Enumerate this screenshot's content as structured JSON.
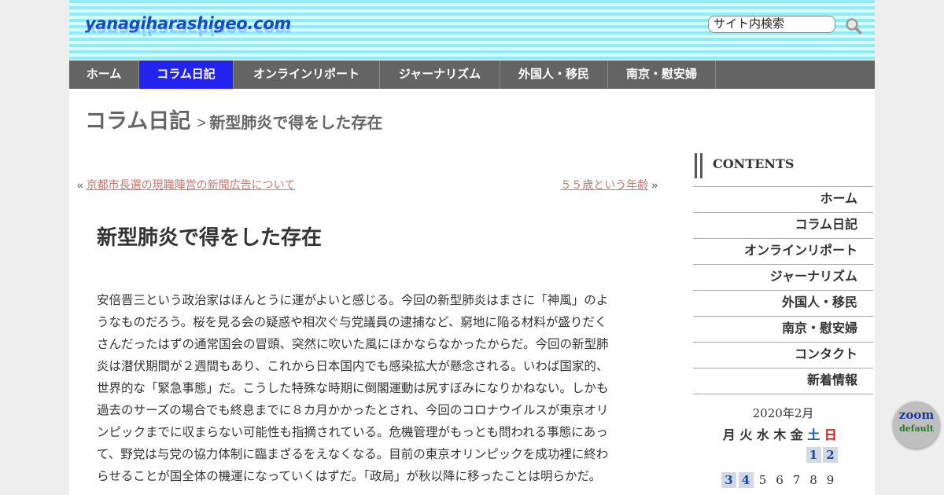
{
  "header": {
    "logo": "yanagiharashigeo.com",
    "search_value": "サイト内検索"
  },
  "nav": {
    "items": [
      {
        "label": "ホーム"
      },
      {
        "label": "コラム日記"
      },
      {
        "label": "オンラインリポート"
      },
      {
        "label": "ジャーナリズム"
      },
      {
        "label": "外国人・移民"
      },
      {
        "label": "南京・慰安婦"
      }
    ],
    "active_index": 1
  },
  "breadcrumb": {
    "section": "コラム日記",
    "separator": ">",
    "current": "新型肺炎で得をした存在"
  },
  "pager": {
    "prev_mark": "«",
    "prev_label": "京都市長選の現職陣営の新聞広告について",
    "next_label": "５５歳という年齢",
    "next_mark": "»"
  },
  "article": {
    "title": "新型肺炎で得をした存在",
    "lines": [
      "安倍晋三という政治家はほんとうに運がよいと感じる。今回の新型肺炎はまさに「神風」のよ",
      "うなものだろう。桜を見る会の疑惑や相次ぐ与党議員の逮捕など、窮地に陥る材料が盛りだく",
      "さんだったはずの通常国会の冒頭、突然に吹いた風にほかならなかったからだ。今回の新型肺",
      "炎は潜伏期間が２週間もあり、これから日本国内でも感染拡大が懸念される。いわば国家的、",
      "世界的な「緊急事態」だ。こうした特殊な時期に倒閣運動は尻すぼみになりかねない。しかも",
      "過去のサーズの場合でも終息までに８カ月かかったとされ、今回のコロナウイルスが東京オリ",
      "ンピックまでに収まらない可能性も指摘されている。危機管理がもっとも問われる事態にあっ",
      "て、野党は与党の協力体制に臨まざるをえなくなる。目前の東京オリンピックを成功裡に終わ",
      "らせることが国全体の機運になっていくはずだ。「政局」が秋以降に移ったことは明らかだ。"
    ]
  },
  "sidebar": {
    "title": "CONTENTS",
    "items": [
      {
        "label": "ホーム"
      },
      {
        "label": "コラム日記"
      },
      {
        "label": "オンラインリポート"
      },
      {
        "label": "ジャーナリズム"
      },
      {
        "label": "外国人・移民"
      },
      {
        "label": "南京・慰安婦"
      },
      {
        "label": "コンタクト"
      },
      {
        "label": "新着情報"
      }
    ]
  },
  "calendar": {
    "title": "2020年2月",
    "weekdays": [
      "月",
      "火",
      "水",
      "木",
      "金",
      "土",
      "日"
    ],
    "row1": [
      {
        "day": "1",
        "linked": true
      },
      {
        "day": "2",
        "linked": true
      }
    ],
    "row2": [
      {
        "day": "3",
        "linked": true
      },
      {
        "day": "4",
        "linked": true
      },
      {
        "day": "5",
        "linked": false
      },
      {
        "day": "6",
        "linked": false
      },
      {
        "day": "7",
        "linked": false
      },
      {
        "day": "8",
        "linked": false
      },
      {
        "day": "9",
        "linked": false
      }
    ]
  },
  "zoom": {
    "label": "zoom",
    "sub": "default"
  }
}
